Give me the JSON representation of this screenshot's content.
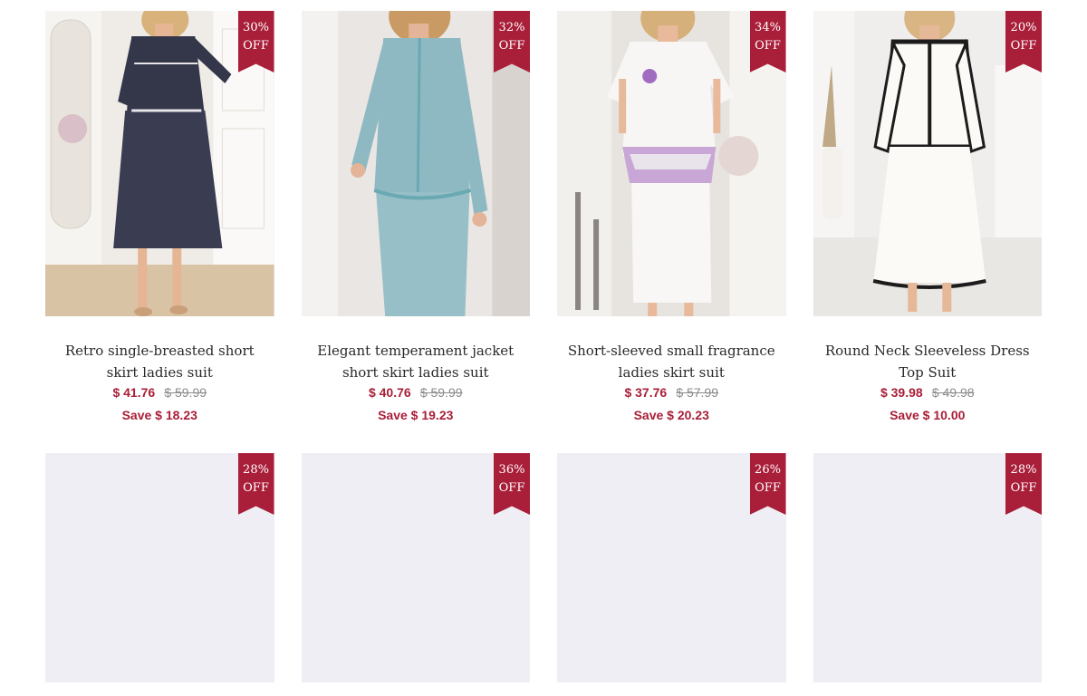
{
  "products_row1": [
    {
      "discount_pct": "30%",
      "discount_word": "OFF",
      "title": "Retro single-breasted short skirt ladies suit",
      "price": "$ 41.76",
      "original_price": "$ 59.99",
      "save": "Save $ 18.23",
      "image": {
        "suit_color": "#34374a",
        "background": "#efece8",
        "skin": "#e6b594",
        "hair": "#d8b27a"
      }
    },
    {
      "discount_pct": "32%",
      "discount_word": "OFF",
      "title": "Elegant temperament jacket short skirt ladies suit",
      "price": "$ 40.76",
      "original_price": "$ 59.99",
      "save": "Save $ 19.23",
      "image": {
        "suit_color": "#8fb9c2",
        "background": "#e9e6e4",
        "skin": "#e3b497",
        "hair": "#c99a63"
      }
    },
    {
      "discount_pct": "34%",
      "discount_word": "OFF",
      "title": "Short-sleeved small fragrance ladies skirt suit",
      "price": "$ 37.76",
      "original_price": "$ 57.99",
      "save": "Save $ 20.23",
      "image": {
        "suit_color": "#f7f6f4",
        "background": "#e7e4e0",
        "skin": "#e8b99b",
        "hair": "#d6b07a"
      }
    },
    {
      "discount_pct": "20%",
      "discount_word": "OFF",
      "title": "Round Neck Sleeveless Dress Top Suit",
      "price": "$ 39.98",
      "original_price": "$ 49.98",
      "save": "Save $ 10.00",
      "image": {
        "suit_color": "#fbfaf7",
        "background": "#efeeed",
        "skin": "#e5b898",
        "hair": "#d9b583"
      }
    }
  ],
  "products_row2": [
    {
      "discount_pct": "28%",
      "discount_word": "OFF"
    },
    {
      "discount_pct": "36%",
      "discount_word": "OFF"
    },
    {
      "discount_pct": "26%",
      "discount_word": "OFF"
    },
    {
      "discount_pct": "28%",
      "discount_word": "OFF"
    }
  ],
  "colors": {
    "accent": "#a91e38",
    "strikethrough": "#8b8b8b",
    "placeholder": "#eeeef4"
  }
}
